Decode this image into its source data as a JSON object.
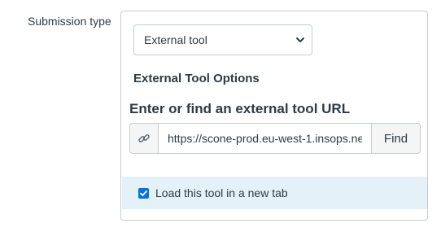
{
  "submission": {
    "label": "Submission type",
    "selected_type": "External tool"
  },
  "external_tool": {
    "section_title": "External Tool Options",
    "url_heading": "Enter or find an external tool URL",
    "url_value": "https://scone-prod.eu-west-1.insops.ne",
    "find_label": "Find",
    "new_tab_label": "Load this tool in a new tab",
    "new_tab_checked": true
  },
  "colors": {
    "accent": "#0075d8",
    "highlight_row": "#e5f1f9",
    "border": "#c7cdd1"
  },
  "icons": {
    "select_arrow": "chevron-down-icon",
    "url_addon": "link-icon",
    "checkbox_mark": "checkmark-icon"
  }
}
